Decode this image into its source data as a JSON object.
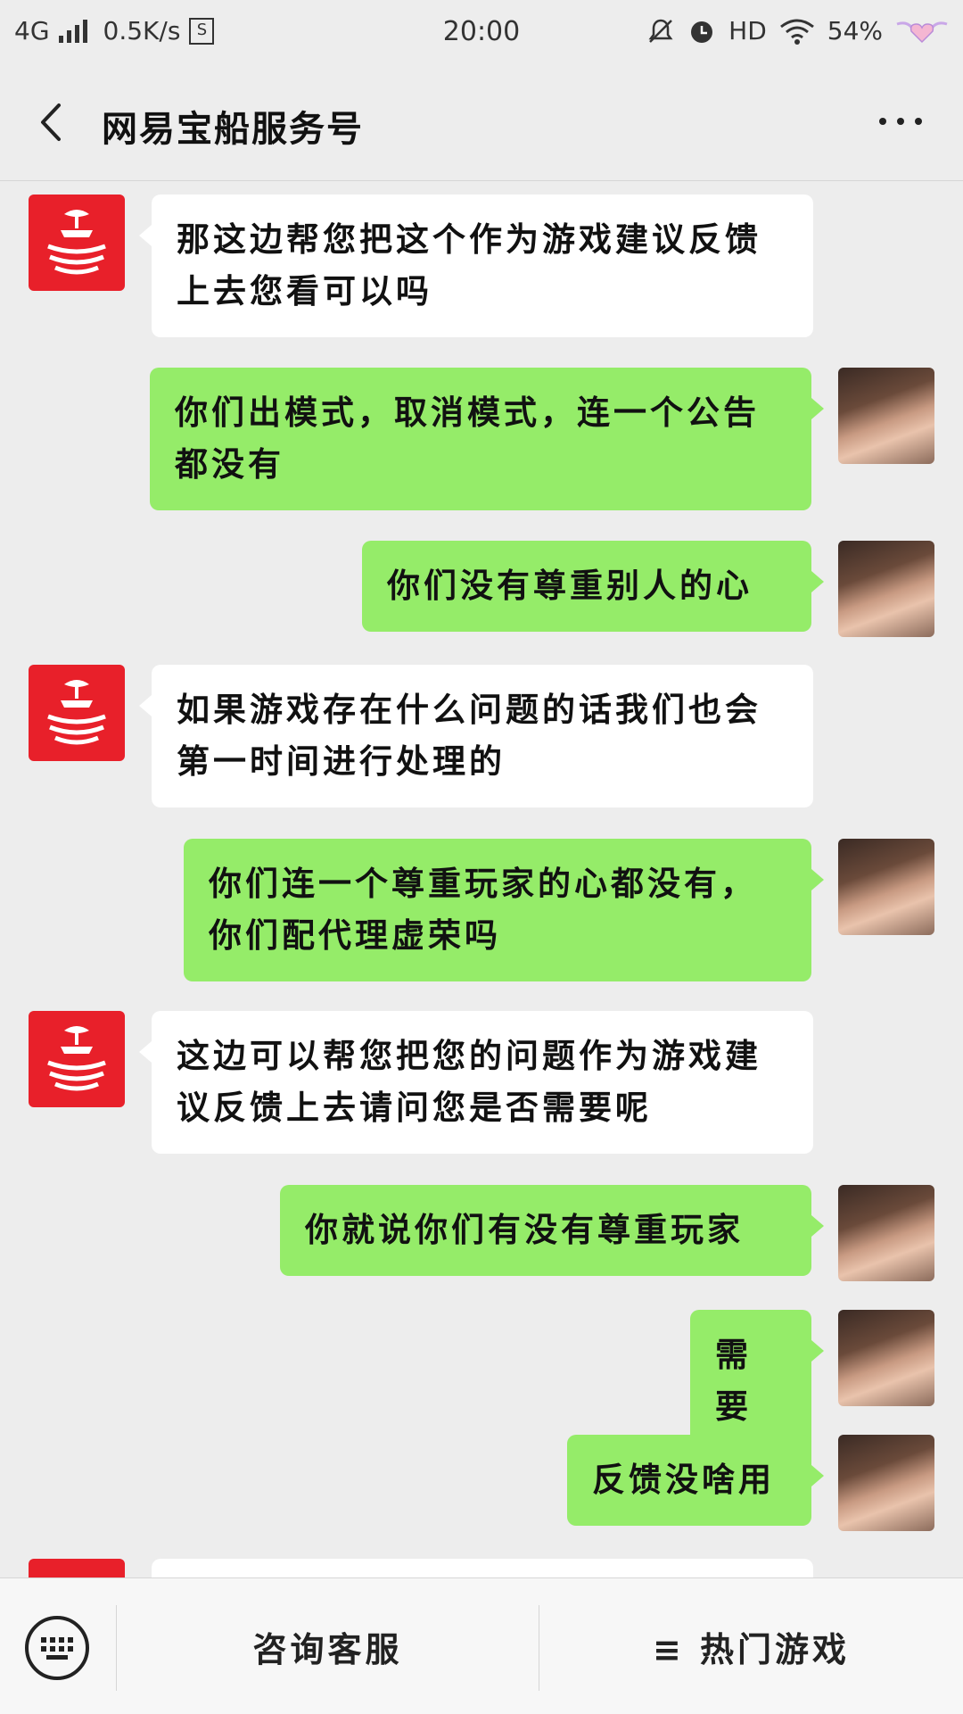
{
  "status_bar": {
    "network": "4G",
    "speed": "0.5K/s",
    "s_badge": "S",
    "time": "20:00",
    "hd": "HD",
    "battery": "54%"
  },
  "nav": {
    "title": "网易宝船服务号"
  },
  "messages": [
    {
      "from": "service",
      "text": "那这边帮您把这个作为游戏建议反馈上去您看可以吗"
    },
    {
      "from": "user",
      "text": "你们出模式，取消模式，连一个公告都没有"
    },
    {
      "from": "user",
      "text": "你们没有尊重别人的心"
    },
    {
      "from": "service",
      "text": "如果游戏存在什么问题的话我们也会第一时间进行处理的"
    },
    {
      "from": "user",
      "text": "你们连一个尊重玩家的心都没有，你们配代理虚荣吗"
    },
    {
      "from": "service",
      "text": "这边可以帮您把您的问题作为游戏建议反馈上去请问您是否需要呢"
    },
    {
      "from": "user",
      "text": "你就说你们有没有尊重玩家"
    },
    {
      "from": "user",
      "text": "需要"
    },
    {
      "from": "user",
      "text": "反馈没啥用"
    }
  ],
  "bottom_menu": {
    "consult_label": "咨询客服",
    "hot_games_label": "≡ 热门游戏"
  },
  "colors": {
    "user_bubble": "#95ec69",
    "service_bubble": "#ffffff",
    "brand_red": "#e8202a",
    "background": "#ededed"
  }
}
